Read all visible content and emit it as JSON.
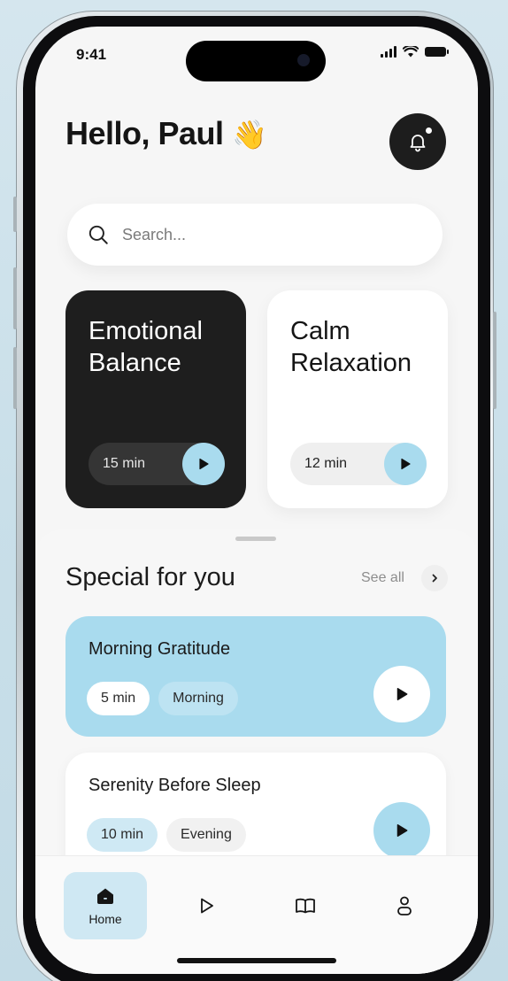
{
  "status_bar": {
    "time": "9:41"
  },
  "header": {
    "greeting": "Hello, Paul",
    "wave_emoji": "👋",
    "bell_icon": "bell-icon"
  },
  "search": {
    "placeholder": "Search..."
  },
  "featured": [
    {
      "title": "Emotional Balance",
      "duration": "15 min",
      "theme": "dark"
    },
    {
      "title": "Calm Relaxation",
      "duration": "12 min",
      "theme": "light"
    }
  ],
  "section": {
    "title": "Special for you",
    "see_all": "See all"
  },
  "sessions": [
    {
      "title": "Morning Gratitude",
      "duration": "5 min",
      "time_of_day": "Morning"
    },
    {
      "title": "Serenity Before Sleep",
      "duration": "10 min",
      "time_of_day": "Evening"
    }
  ],
  "tabbar": {
    "items": [
      {
        "label": "Home",
        "icon": "home-icon",
        "active": true
      },
      {
        "label": "",
        "icon": "play-icon",
        "active": false
      },
      {
        "label": "",
        "icon": "book-icon",
        "active": false
      },
      {
        "label": "",
        "icon": "profile-icon",
        "active": false
      }
    ]
  },
  "colors": {
    "accent": "#a9dbee",
    "dark_card": "#1e1e1e",
    "background": "#f6f6f6"
  }
}
